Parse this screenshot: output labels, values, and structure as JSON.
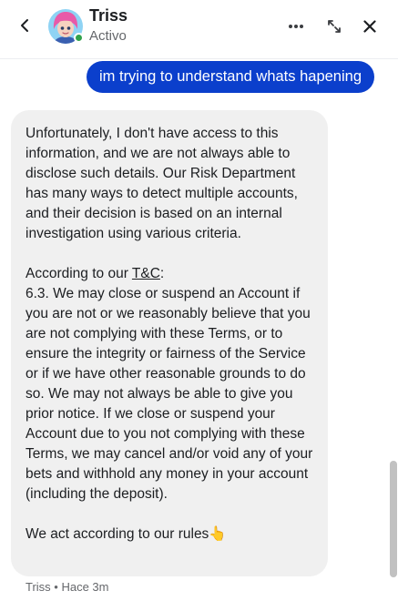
{
  "header": {
    "name": "Triss",
    "status": "Activo",
    "icons": {
      "back": "chevron-left-icon",
      "more": "more-horizontal-icon",
      "expand": "expand-arrows-icon",
      "close": "close-icon"
    }
  },
  "messages": {
    "outgoing": {
      "text": "im trying to understand whats hapening",
      "bubble_color": "#0b3fcc"
    },
    "incoming": {
      "paragraph1": "Unfortunately, I don't have access to this information, and we are not always able to disclose such details. Our Risk Department has many ways to detect multiple accounts, and their decision is based on an internal investigation using various criteria.",
      "according_prefix": "According to our ",
      "tc_link": "T&C",
      "according_suffix": ":",
      "paragraph2": "6.3. We may close or suspend an Account if you are not or we reasonably believe that you are not complying with these Terms, or to ensure the integrity or fairness of the Service or if we have other reasonable grounds to do so. We may not always be able to give you prior notice. If we close or suspend your Account due to you not complying with these Terms, we may cancel and/or void any of your bets and withhold any money in your account (including the deposit).",
      "closing": "We act according to our rules",
      "closing_emoji": "👆",
      "bubble_color": "#f0f0f0"
    },
    "meta": "Triss • Hace 3m"
  },
  "colors": {
    "accent": "#0b3fcc",
    "online": "#31a24c",
    "muted_text": "#65676b"
  }
}
